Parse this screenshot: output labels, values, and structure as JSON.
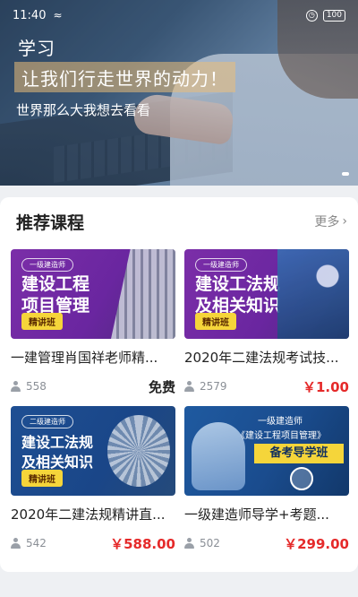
{
  "status_bar": {
    "time": "11:40",
    "wifi_icon": "wifi-icon",
    "alarm_icon": "alarm-icon",
    "battery": "100"
  },
  "banner": {
    "title": "学习",
    "slogan": "让我们行走世界的动力！",
    "subtitle": "世界那么大我想去看看"
  },
  "section": {
    "title": "推荐课程",
    "more_label": "更多",
    "more_icon": "chevron-right-icon"
  },
  "courses": [
    {
      "thumb_tag": "一级建造师",
      "thumb_title_1": "建设工程",
      "thumb_title_2": "项目管理",
      "thumb_badge": "精讲班",
      "name": "一建管理肖国祥老师精...",
      "students": "558",
      "price": "免费"
    },
    {
      "thumb_tag": "一级建造师",
      "thumb_title_1": "建设工法规",
      "thumb_title_2": "及相关知识",
      "thumb_badge": "精讲班",
      "name": "2020年二建法规考试技...",
      "students": "2579",
      "price": "￥1.00"
    },
    {
      "thumb_tag": "二级建造师",
      "thumb_title_1": "建设工法规",
      "thumb_title_2": "及相关知识",
      "thumb_badge": "精讲班",
      "name": "2020年二建法规精讲直...",
      "students": "542",
      "price": "￥588.00"
    },
    {
      "thumb_tag": "一级建造师",
      "thumb_title_1": "《建设工程项目管理》",
      "thumb_title_2": "备考导学班",
      "thumb_badge": "",
      "name": "一级建造师导学+考题...",
      "students": "502",
      "price": "￥299.00"
    }
  ],
  "colors": {
    "accent_price": "#e52a2a",
    "section_bg": "#eef0f3"
  }
}
